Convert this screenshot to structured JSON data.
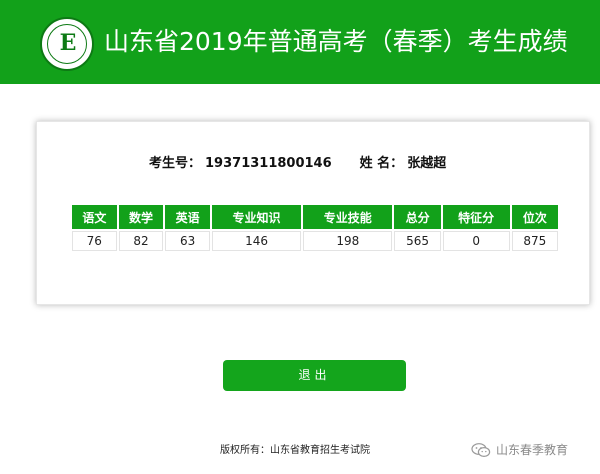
{
  "header": {
    "title": "山东省2019年普通高考（春季）考生成绩"
  },
  "student": {
    "exam_no_label": "考生号：",
    "exam_no": "19371311800146",
    "name_label": "姓 名：",
    "name": "张越超"
  },
  "scores": {
    "headers": [
      "语文",
      "数学",
      "英语",
      "专业知识",
      "专业技能",
      "总分",
      "特征分",
      "位次"
    ],
    "values": [
      "76",
      "82",
      "63",
      "146",
      "198",
      "565",
      "0",
      "875"
    ]
  },
  "actions": {
    "exit_label": "退出"
  },
  "footer": {
    "copyright": "版权所有：山东省教育招生考试院"
  },
  "watermark": {
    "text": "山东春季教育",
    "icon": "wechat-icon"
  },
  "colors": {
    "brand_green": "#12a11a",
    "button_green": "#14a51c"
  }
}
